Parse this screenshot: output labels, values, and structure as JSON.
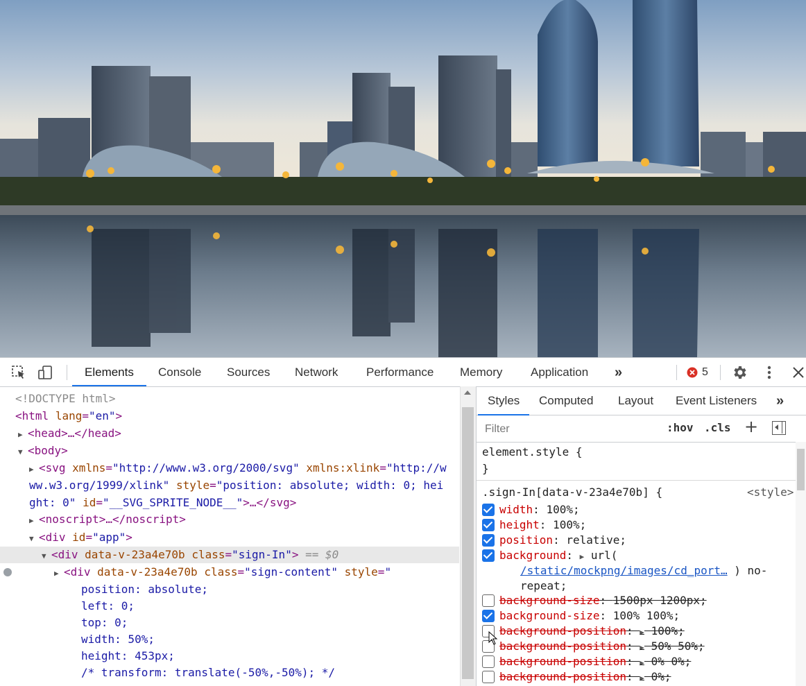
{
  "devtools": {
    "toolbar": {
      "inspect_icon": "inspect-element-icon",
      "device_icon": "device-toolbar-icon",
      "tabs": [
        {
          "label": "Elements",
          "active": true
        },
        {
          "label": "Console"
        },
        {
          "label": "Sources"
        },
        {
          "label": "Network"
        },
        {
          "label": "Performance"
        },
        {
          "label": "Memory"
        },
        {
          "label": "Application"
        }
      ],
      "more_tabs": "»",
      "error_count": "5",
      "error_color": "#d93025",
      "accent_color": "#1a73e8"
    },
    "dom": {
      "doctype": "<!DOCTYPE html>",
      "html_open": "<html",
      "html_lang_attr": "lang",
      "html_lang_val": "\"en\"",
      "html_close": ">",
      "head": "<head>…</head>",
      "body": "<body>",
      "svg_tag": "<svg",
      "svg_l1_a1": "xmlns",
      "svg_l1_v1": "\"http://www.w3.org/2000/svg\"",
      "svg_l1_a2": "xmlns:xlink",
      "svg_l1_v2a": "\"http://w",
      "svg_l2_v2b": "ww.w3.org/1999/xlink\"",
      "svg_l2_a3": "style",
      "svg_l2_v3a": "\"position: absolute; width: 0; hei",
      "svg_l3_v3b": "ght: 0\"",
      "svg_l3_a4": "id",
      "svg_l3_v4": "\"__SVG_SPRITE_NODE__\"",
      "svg_l3_end": ">…</svg>",
      "noscript": "<noscript>…</noscript>",
      "div_app_open": "<div",
      "div_app_attr": "id",
      "div_app_val": "\"app\"",
      "div_app_close": ">",
      "sel_open": "<div",
      "sel_attr1": "data-v-23a4e70b",
      "sel_attr2": "class",
      "sel_val2": "\"sign-In\"",
      "sel_close": ">",
      "sel_marker": "== $0",
      "content_open": "<div",
      "content_attr1": "data-v-23a4e70b",
      "content_attr2": "class",
      "content_val2": "\"sign-content\"",
      "content_attr3": "style",
      "content_val3_start": "\"",
      "style_lines": [
        "position: absolute;",
        "left: 0;",
        "top: 0;",
        "width: 50%;",
        "height: 453px;"
      ],
      "comment_line": "/* transform: translate(-50%,-50%); */"
    },
    "styles": {
      "tabs": [
        {
          "label": "Styles",
          "active": true
        },
        {
          "label": "Computed"
        },
        {
          "label": "Layout"
        },
        {
          "label": "Event Listeners"
        }
      ],
      "more_tabs": "»",
      "filter_placeholder": "Filter",
      "hov": ":hov",
      "cls": ".cls",
      "add": "+",
      "element_style_open": "element.style {",
      "element_style_close": "}",
      "rule_selector": ".sign-In[data-v-23a4e70b] {",
      "rule_source": "<style>",
      "decls": [
        {
          "prop": "width",
          "value": "100%;",
          "checked": true,
          "overridden": false
        },
        {
          "prop": "height",
          "value": "100%;",
          "checked": true,
          "overridden": false
        },
        {
          "prop": "position",
          "value": "relative;",
          "checked": true,
          "overridden": false
        },
        {
          "prop": "background",
          "value": "url(",
          "checked": true,
          "overridden": false
        },
        {
          "prop": "background-size",
          "value": "1500px 1200px;",
          "checked": false,
          "overridden": true
        },
        {
          "prop": "background-size",
          "value": "100% 100%;",
          "checked": true,
          "overridden": false
        },
        {
          "prop": "background-position",
          "value": "100%;",
          "checked": false,
          "overridden": true
        },
        {
          "prop": "background-position",
          "value": "50% 50%;",
          "checked": false,
          "overridden": true
        },
        {
          "prop": "background-position",
          "value": "0% 0%;",
          "checked": false,
          "overridden": true
        },
        {
          "prop": "background-position",
          "value": "0%;",
          "checked": false,
          "overridden": true
        }
      ],
      "bg_url": "/static/mockpng/images/cd_port…",
      "bg_url_end": ") no-",
      "bg_repeat": "repeat;"
    }
  }
}
